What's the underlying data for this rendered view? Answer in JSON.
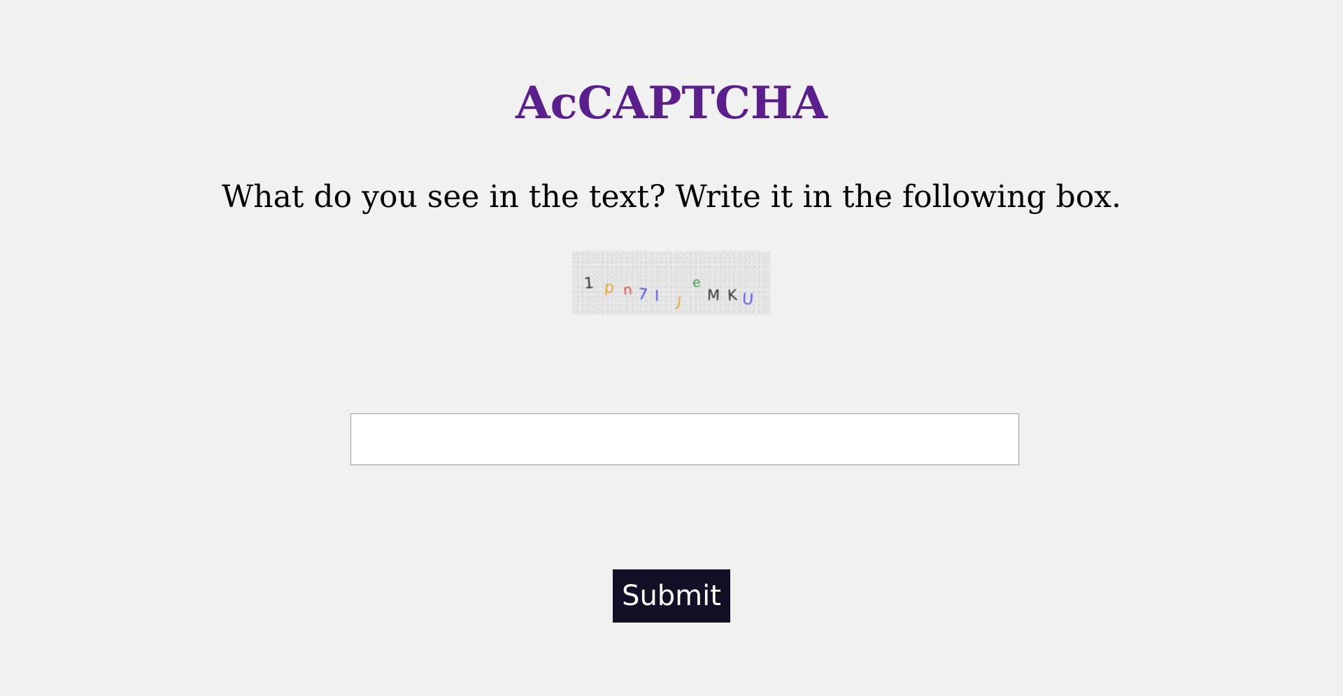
{
  "header": {
    "title": "AcCAPTCHA",
    "title_color": "#5b1f8c"
  },
  "prompt": {
    "instruction": "What do you see in the text? Write it in the following box."
  },
  "captcha": {
    "characters": [
      {
        "char": "1",
        "color": "#333333"
      },
      {
        "char": "p",
        "color": "#e8a33a"
      },
      {
        "char": "n",
        "color": "#e04b4b"
      },
      {
        "char": "7",
        "color": "#4b55e0"
      },
      {
        "char": "I",
        "color": "#4b55e0"
      },
      {
        "char": "J",
        "color": "#e8a33a"
      },
      {
        "char": "e",
        "color": "#3f9e4a"
      },
      {
        "char": "M",
        "color": "#333333"
      },
      {
        "char": "K",
        "color": "#333333"
      },
      {
        "char": "U",
        "color": "#5a5ae8"
      }
    ]
  },
  "form": {
    "answer_value": "",
    "answer_placeholder": "",
    "submit_label": "Submit",
    "submit_bg": "#120f26"
  }
}
